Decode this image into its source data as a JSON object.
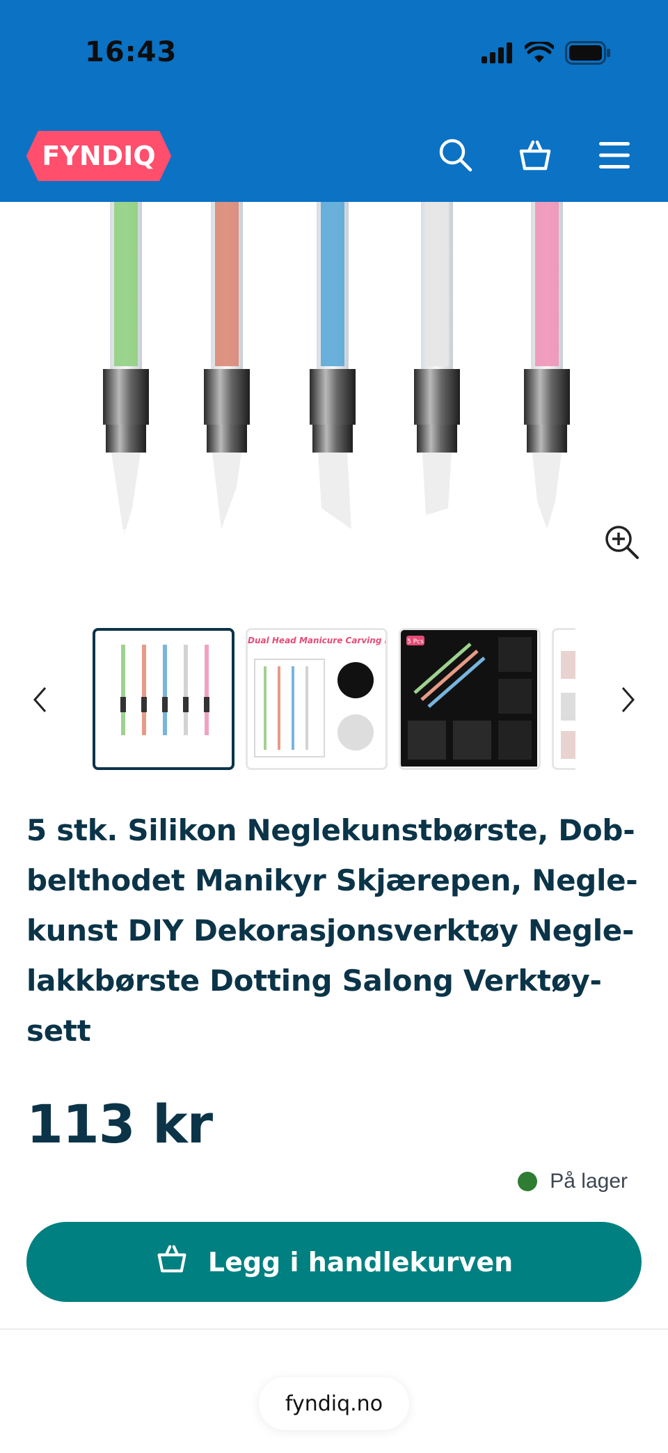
{
  "status_bar": {
    "time": "16:43",
    "icons": [
      "cellular-signal-icon",
      "wifi-icon",
      "battery-icon"
    ]
  },
  "header": {
    "logo_text": "FYNDIQ",
    "icons": [
      "search-icon",
      "basket-icon",
      "menu-icon"
    ],
    "background": "#0b72c4",
    "logo_color": "#ff4f6d"
  },
  "gallery": {
    "main_image": "product-image-silicone-nail-brushes",
    "zoom_icon": "zoom-in-icon",
    "prev_icon": "chevron-left-icon",
    "next_icon": "chevron-right-icon",
    "thumbnails": [
      {
        "name": "thumbnail-1",
        "active": true
      },
      {
        "name": "thumbnail-2",
        "caption": "Dual Head Manicure Carving Pen",
        "active": false
      },
      {
        "name": "thumbnail-3",
        "caption": "5 Pcs",
        "active": false
      },
      {
        "name": "thumbnail-4",
        "active": false
      }
    ]
  },
  "product": {
    "title_lines": [
      "5 stk. Silikon Neglekunstbørste, Dob-",
      "belthodet Manikyr Skjærepen, Negle-",
      "kunst DIY Dekorasjonsverktøy Negle-",
      "lakkbørste Dotting Salong Verktøy-",
      "sett"
    ],
    "price": "113 kr",
    "stock": "På lager",
    "stock_color": "#2e7d32"
  },
  "cta": {
    "label": "Legg i handlekurven",
    "icon": "basket-icon",
    "color": "#008080"
  },
  "browser": {
    "url": "fyndiq.no"
  }
}
